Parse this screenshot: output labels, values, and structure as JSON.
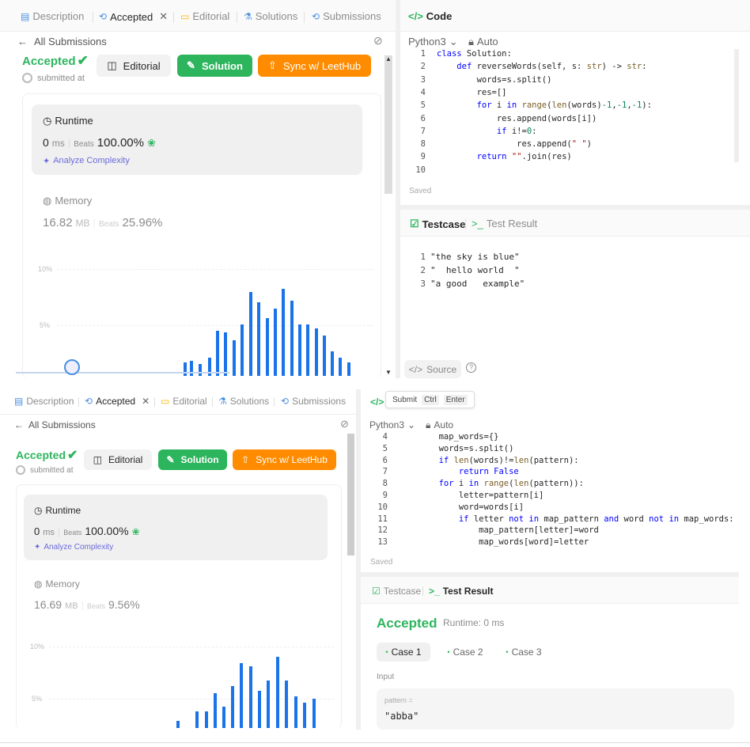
{
  "colors": {
    "accent_green": "#2db55d",
    "accent_orange": "#ff8c00",
    "bar_blue": "#1a73e8",
    "tab_blue": "#4a90e2"
  },
  "top": {
    "tabs": [
      "Description",
      "Accepted",
      "Editorial",
      "Solutions",
      "Submissions"
    ],
    "code_tab": "Code",
    "back": "All Submissions",
    "status": "Accepted",
    "submitted": "submitted at",
    "buttons": {
      "editorial": "Editorial",
      "solution": "Solution",
      "sync": "Sync w/ LeetHub"
    },
    "runtime": {
      "label": "Runtime",
      "value": "0",
      "unit": "ms",
      "beats_label": "Beats",
      "beats": "100.00%",
      "analyze": "Analyze Complexity"
    },
    "memory": {
      "label": "Memory",
      "value": "16.82",
      "unit": "MB",
      "beats_label": "Beats",
      "beats": "25.96%"
    },
    "axis": [
      "10%",
      "5%"
    ],
    "lang": "Python3",
    "mode": "Auto",
    "code_lines": [
      {
        "n": "1",
        "t": "class Solution:"
      },
      {
        "n": "2",
        "t": "    def reverseWords(self, s: str) -> str:"
      },
      {
        "n": "3",
        "t": "        words=s.split()"
      },
      {
        "n": "4",
        "t": "        res=[]"
      },
      {
        "n": "5",
        "t": "        for i in range(len(words)-1,-1,-1):"
      },
      {
        "n": "6",
        "t": "            res.append(words[i])"
      },
      {
        "n": "7",
        "t": "            if i!=0:"
      },
      {
        "n": "8",
        "t": "                res.append(\" \")"
      },
      {
        "n": "9",
        "t": "        return \"\".join(res)"
      },
      {
        "n": "10",
        "t": ""
      }
    ],
    "saved": "Saved",
    "testcase_tab": "Testcase",
    "result_tab": "Test Result",
    "cases": [
      {
        "n": "1",
        "t": "\"the sky is blue\""
      },
      {
        "n": "2",
        "t": "\"  hello world  \""
      },
      {
        "n": "3",
        "t": "\"a good   example\""
      }
    ],
    "source": "Source"
  },
  "bottom": {
    "tabs": [
      "Description",
      "Accepted",
      "Editorial",
      "Solutions",
      "Submissions"
    ],
    "submit_hint": "Submit",
    "ctrl": "Ctrl",
    "enter": "Enter",
    "back": "All Submissions",
    "status": "Accepted",
    "submitted": "submitted at",
    "buttons": {
      "editorial": "Editorial",
      "solution": "Solution",
      "sync": "Sync w/ LeetHub"
    },
    "runtime": {
      "label": "Runtime",
      "value": "0",
      "unit": "ms",
      "beats_label": "Beats",
      "beats": "100.00%",
      "analyze": "Analyze Complexity"
    },
    "memory": {
      "label": "Memory",
      "value": "16.69",
      "unit": "MB",
      "beats_label": "Beats",
      "beats": "9.56%"
    },
    "axis": [
      "10%",
      "5%"
    ],
    "lang": "Python3",
    "mode": "Auto",
    "code_lines": [
      {
        "n": "4",
        "t": "        map_words={}"
      },
      {
        "n": "5",
        "t": "        words=s.split()"
      },
      {
        "n": "6",
        "t": "        if len(words)!=len(pattern):"
      },
      {
        "n": "7",
        "t": "            return False"
      },
      {
        "n": "8",
        "t": "        for i in range(len(pattern)):"
      },
      {
        "n": "9",
        "t": "            letter=pattern[i]"
      },
      {
        "n": "10",
        "t": "            word=words[i]"
      },
      {
        "n": "11",
        "t": "            if letter not in map_pattern and word not in map_words:"
      },
      {
        "n": "12",
        "t": "                map_pattern[letter]=word"
      },
      {
        "n": "13",
        "t": "                map_words[word]=letter"
      }
    ],
    "saved": "Saved",
    "testcase_tab": "Testcase",
    "result_tab": "Test Result",
    "result_status": "Accepted",
    "result_runtime": "Runtime: 0 ms",
    "case_tabs": [
      "Case 1",
      "Case 2",
      "Case 3"
    ],
    "input_label": "Input",
    "param_name": "pattern =",
    "param_value": "\"abba\""
  }
}
